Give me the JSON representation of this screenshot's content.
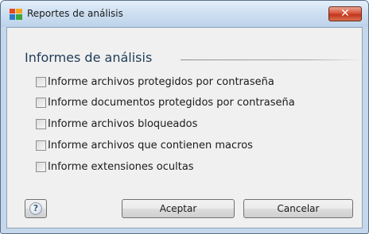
{
  "window": {
    "title": "Reportes de análisis",
    "close_glyph": "✕"
  },
  "main": {
    "heading": "Informes de análisis",
    "options": [
      {
        "label": "Informe archivos protegidos por contraseña",
        "checked": false
      },
      {
        "label": "Informe documentos protegidos por contraseña",
        "checked": false
      },
      {
        "label": "Informe archivos bloqueados",
        "checked": false
      },
      {
        "label": "Informe archivos que contienen macros",
        "checked": false
      },
      {
        "label": "Informe extensiones ocultas",
        "checked": false
      }
    ]
  },
  "footer": {
    "help_glyph": "?",
    "ok_label": "Aceptar",
    "cancel_label": "Cancelar"
  },
  "icons": {
    "app": "avg-app-icon",
    "close": "close-icon",
    "help": "help-icon"
  },
  "colors": {
    "close_button": "#c2361c",
    "heading": "#1e3b58"
  }
}
